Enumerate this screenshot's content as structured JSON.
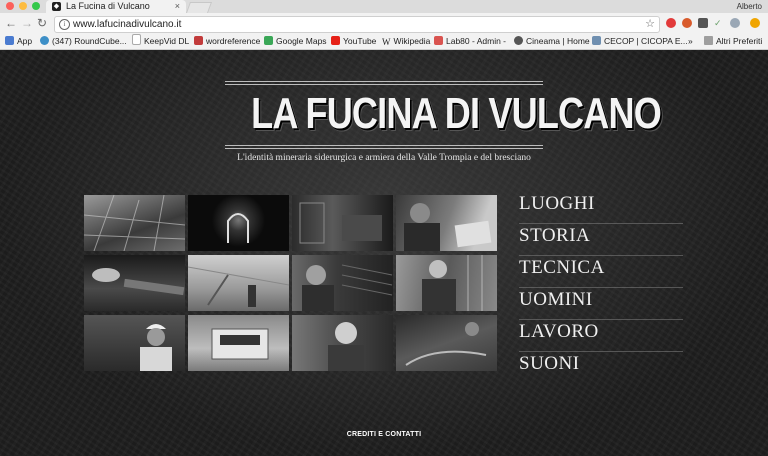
{
  "browser": {
    "tab_title": "La Fucina di Vulcano",
    "tab_close": "×",
    "user_name": "Alberto",
    "url": "www.lafucinadivulcano.it",
    "nav_back": "←",
    "nav_forward": "→",
    "nav_reload": "↻",
    "info_glyph": "i",
    "star_glyph": "☆",
    "bookmarks": [
      {
        "label": "App",
        "icon": "apps-grid-icon",
        "color": "#4a7bd0"
      },
      {
        "label": "(347) RoundCube...",
        "icon": "roundcube-icon",
        "color": "#3d8fc7"
      },
      {
        "label": "KeepVid DL",
        "icon": "page-icon",
        "color": "#bdbdbd"
      },
      {
        "label": "wordreference",
        "icon": "wordreference-icon",
        "color": "#c23b3b"
      },
      {
        "label": "Google Maps",
        "icon": "maps-icon",
        "color": "#3aa757"
      },
      {
        "label": "YouTube",
        "icon": "youtube-icon",
        "color": "#e62117"
      },
      {
        "label": "Wikipedia",
        "icon": "wikipedia-icon",
        "color": "#444444"
      },
      {
        "label": "Lab80 - Admin -",
        "icon": "lab80-icon",
        "color": "#d9534f"
      },
      {
        "label": "Cineama | Home",
        "icon": "cineama-icon",
        "color": "#555555"
      },
      {
        "label": "CECOP | CICOPA E...",
        "icon": "cecop-icon",
        "color": "#6f8fb0"
      }
    ],
    "other_bookmarks": "Altri Preferiti",
    "more_glyph": "»"
  },
  "site": {
    "title": "LA FUCINA DI VULCANO",
    "subtitle": "L'identità mineraria siderurgica e armiera della Valle Trompia e del bresciano",
    "menu": [
      "LUOGHI",
      "STORIA",
      "TECNICA",
      "UOMINI",
      "LAVORO",
      "SUONI"
    ],
    "credits": "CREDITI E CONTATTI"
  },
  "colors": {
    "background": "#1e1e1e",
    "text": "#f0f0f0",
    "chrome": "#f2f2f2"
  }
}
